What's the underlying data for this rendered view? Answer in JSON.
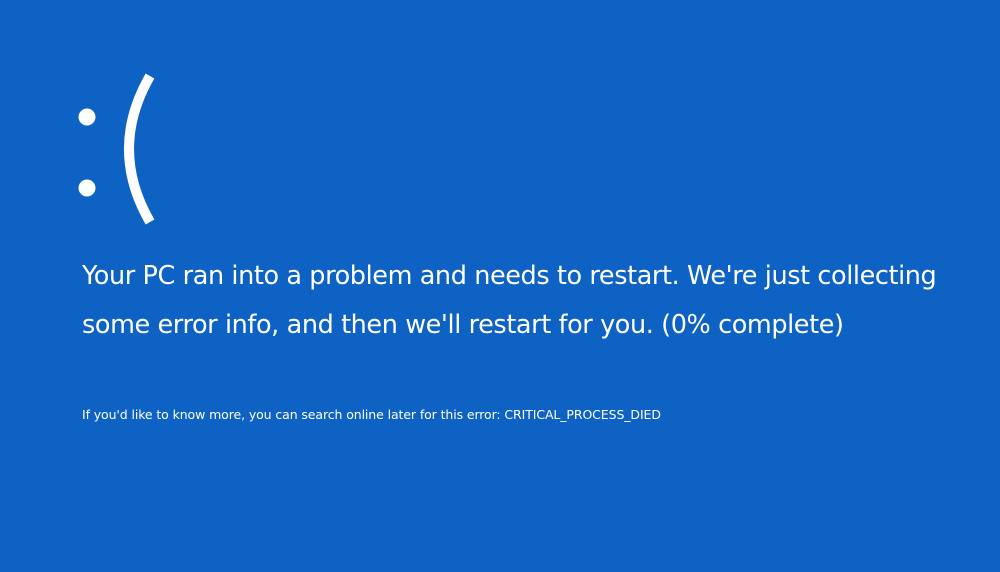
{
  "screen": {
    "emoticon": ":(",
    "message": "Your PC ran into a problem and needs to restart. We're just collecting some error info, and then we'll restart for you. (0% complete)",
    "more_info": "If you'd like to know more, you can search online later for this error: CRITICAL_PROCESS_DIED",
    "progress_percent": 0
  },
  "colors": {
    "background": "#0d62c4",
    "text": "#ffffff"
  }
}
